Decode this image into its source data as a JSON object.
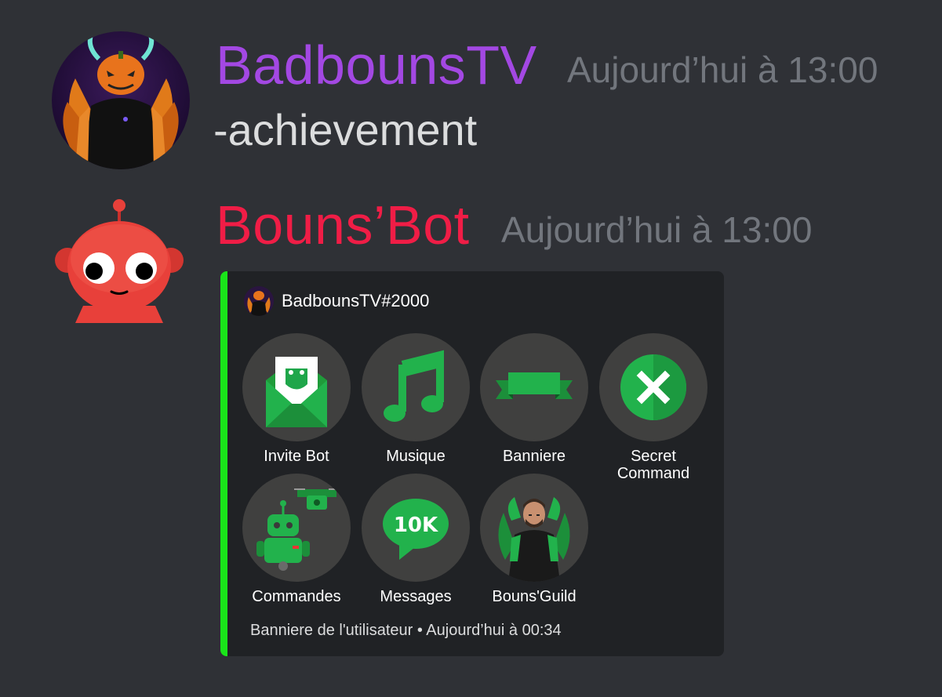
{
  "messages": [
    {
      "username": "BadbounsTV",
      "username_color": "#a348e3",
      "timestamp": "Aujourd’hui à 13:00",
      "content": "-achievement"
    },
    {
      "username": "Bouns’Bot",
      "username_color": "#f01d46",
      "timestamp": "Aujourd’hui à 13:00"
    }
  ],
  "embed": {
    "accent_color": "#1ae51a",
    "author": "BadbounsTV#2000",
    "items": [
      {
        "label": "Invite Bot",
        "icon": "envelope-invite-icon"
      },
      {
        "label": "Musique",
        "icon": "music-note-icon"
      },
      {
        "label": "Banniere",
        "icon": "banner-ribbon-icon"
      },
      {
        "label": "Secret\nCommand",
        "label_line1": "Secret",
        "label_line2": "Command",
        "icon": "close-circle-icon"
      },
      {
        "label": "Commandes",
        "icon": "robot-drone-icon"
      },
      {
        "label": "Messages",
        "icon": "speech-bubble-10k-icon",
        "badge": "10K"
      },
      {
        "label": "Bouns'Guild",
        "icon": "guild-avatar-icon"
      }
    ],
    "footer": "Banniere de l'utilisateur • Aujourd’hui à 00:34"
  }
}
